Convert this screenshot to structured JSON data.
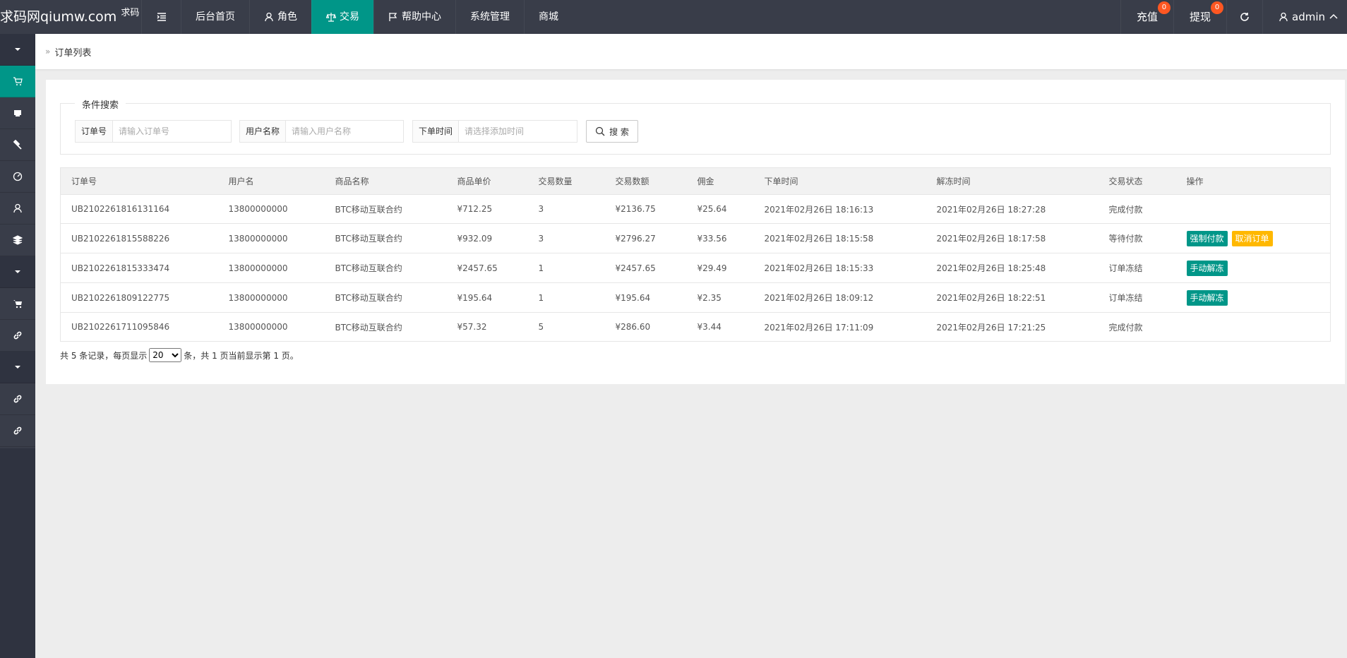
{
  "header": {
    "logo_main": "求码网qiumw.com",
    "logo_small": "求码 ...",
    "nav": [
      {
        "label": "后台首页",
        "icon": "home"
      },
      {
        "label": "角色",
        "icon": "user-icon"
      },
      {
        "label": "交易",
        "icon": "balance-scale-icon",
        "active": true
      },
      {
        "label": "帮助中心",
        "icon": "flag-icon"
      },
      {
        "label": "系统管理",
        "icon": ""
      },
      {
        "label": "商城",
        "icon": ""
      }
    ],
    "recharge_label": "充值",
    "recharge_badge": "0",
    "withdraw_label": "提现",
    "withdraw_badge": "0",
    "user_label": "admin"
  },
  "breadcrumb": {
    "current": "订单列表"
  },
  "search": {
    "legend": "条件搜索",
    "order_label": "订单号",
    "order_placeholder": "请输入订单号",
    "user_label": "用户名称",
    "user_placeholder": "请输入用户名称",
    "time_label": "下单时间",
    "time_placeholder": "请选择添加时间",
    "button_label": "搜 索"
  },
  "table": {
    "headers": [
      "订单号",
      "用户名",
      "商品名称",
      "商品单价",
      "交易数量",
      "交易数额",
      "佣金",
      "下单时间",
      "解冻时间",
      "交易状态",
      "操作"
    ],
    "rows": [
      {
        "order": "UB2102261816131164",
        "user": "13800000000",
        "product": "BTC移动互联合约",
        "price": "¥712.25",
        "qty": "3",
        "amount": "¥2136.75",
        "commission": "¥25.64",
        "order_time": "2021年02月26日 18:16:13",
        "unfreeze_time": "2021年02月26日 18:27:28",
        "status": "完成付款",
        "actions": []
      },
      {
        "order": "UB2102261815588226",
        "user": "13800000000",
        "product": "BTC移动互联合约",
        "price": "¥932.09",
        "qty": "3",
        "amount": "¥2796.27",
        "commission": "¥33.56",
        "order_time": "2021年02月26日 18:15:58",
        "unfreeze_time": "2021年02月26日 18:17:58",
        "status": "等待付款",
        "actions": [
          "强制付款",
          "取消订单"
        ]
      },
      {
        "order": "UB2102261815333474",
        "user": "13800000000",
        "product": "BTC移动互联合约",
        "price": "¥2457.65",
        "qty": "1",
        "amount": "¥2457.65",
        "commission": "¥29.49",
        "order_time": "2021年02月26日 18:15:33",
        "unfreeze_time": "2021年02月26日 18:25:48",
        "status": "订单冻结",
        "actions": [
          "手动解冻"
        ]
      },
      {
        "order": "UB2102261809122775",
        "user": "13800000000",
        "product": "BTC移动互联合约",
        "price": "¥195.64",
        "qty": "1",
        "amount": "¥195.64",
        "commission": "¥2.35",
        "order_time": "2021年02月26日 18:09:12",
        "unfreeze_time": "2021年02月26日 18:22:51",
        "status": "订单冻结",
        "actions": [
          "手动解冻"
        ]
      },
      {
        "order": "UB2102261711095846",
        "user": "13800000000",
        "product": "BTC移动互联合约",
        "price": "¥57.32",
        "qty": "5",
        "amount": "¥286.60",
        "commission": "¥3.44",
        "order_time": "2021年02月26日 17:11:09",
        "unfreeze_time": "2021年02月26日 17:21:25",
        "status": "完成付款",
        "actions": []
      }
    ]
  },
  "pager": {
    "prefix": "共 5 条记录，每页显示",
    "page_size": "20",
    "suffix": "条，共 1 页当前显示第 1 页。"
  },
  "colors": {
    "header_bg": "#393d49",
    "accent": "#009688",
    "warning": "#ffb800",
    "badge": "#ff5722"
  }
}
